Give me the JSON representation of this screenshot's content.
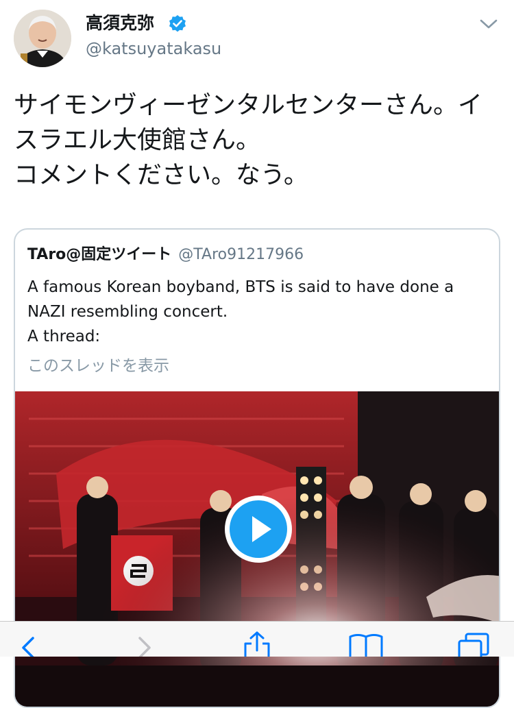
{
  "tweet": {
    "author": {
      "display_name": "高須克弥",
      "handle": "@katsuyatakasu",
      "verified": true
    },
    "text": "サイモンヴィーゼンタルセンターさん。イスラエル大使館さん。\nコメントください。なう。"
  },
  "quoted_tweet": {
    "display_name": "TAro@固定ツイート",
    "handle": "@TAro91217966",
    "text": "A famous Korean boyband, BTS is said to have done a NAZI resembling concert.\nA thread:",
    "thread_link": "このスレッドを表示"
  },
  "video": {
    "state": "paused"
  },
  "browser_toolbar": {
    "items": [
      "back",
      "forward",
      "share",
      "bookmarks",
      "tabs"
    ]
  },
  "colors": {
    "accent": "#1da1f2",
    "text": "#14171a",
    "secondary_text": "#657786",
    "thread_link": "#8899a6",
    "ios_blue": "#007aff",
    "border": "#ccd6dd"
  }
}
